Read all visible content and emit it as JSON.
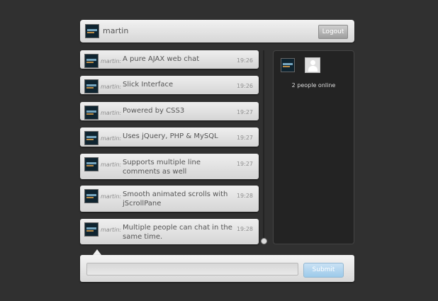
{
  "header": {
    "username": "martin",
    "logout_label": "Logout"
  },
  "messages": [
    {
      "author": "martin:",
      "text": "A pure AJAX web chat",
      "time": "19:26"
    },
    {
      "author": "martin:",
      "text": "Slick Interface",
      "time": "19:26"
    },
    {
      "author": "martin:",
      "text": "Powered by CSS3",
      "time": "19:27"
    },
    {
      "author": "martin:",
      "text": "Uses jQuery, PHP & MySQL",
      "time": "19:27"
    },
    {
      "author": "martin:",
      "text": "Supports multiple line comments as well",
      "time": "19:27"
    },
    {
      "author": "martin:",
      "text": "Smooth animated scrolls with jScrollPane",
      "time": "19:28"
    },
    {
      "author": "martin:",
      "text": "Multiple people can chat in the same time.",
      "time": "19:28"
    }
  ],
  "users": {
    "online_text": "2 people online",
    "avatar_icons": [
      "user-avatar-icon",
      "default-user-icon"
    ]
  },
  "input": {
    "value": "",
    "placeholder": "",
    "submit_label": "Submit"
  },
  "colors": {
    "background": "#303030",
    "panel": "#232323",
    "submit_accent": "#9ccaea"
  }
}
